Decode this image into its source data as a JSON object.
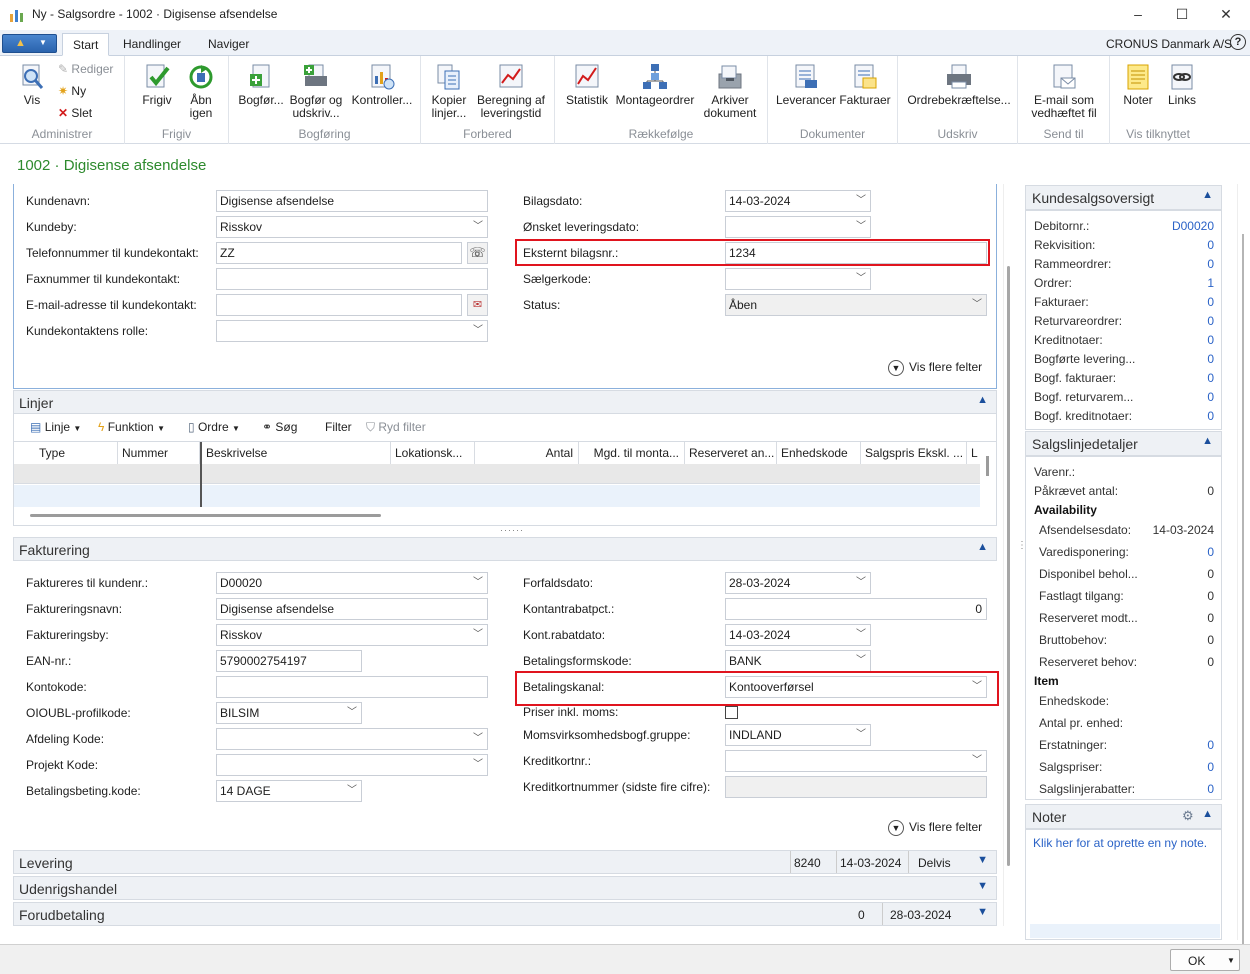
{
  "window": {
    "title": "Ny - Salgsordre - 1002 · Digisense afsendelse",
    "company": "CRONUS Danmark A/S"
  },
  "tabs": [
    "Start",
    "Handlinger",
    "Naviger"
  ],
  "ribbon": {
    "groups": [
      {
        "label": "Administrer",
        "buttons": [
          "Vis"
        ],
        "small": [
          "Rediger",
          "Ny",
          "Slet"
        ]
      },
      {
        "label": "Frigiv",
        "buttons": [
          "Frigiv",
          "Åbn igen"
        ]
      },
      {
        "label": "Bogføring",
        "buttons": [
          "Bogfør...",
          "Bogfør og udskriv...",
          "Kontroller..."
        ]
      },
      {
        "label": "Forbered",
        "buttons": [
          "Kopier linjer...",
          "Beregning af leveringstid"
        ]
      },
      {
        "label": "Rækkefølge",
        "buttons": [
          "Statistik",
          "Montageordrer",
          "Arkiver dokument"
        ]
      },
      {
        "label": "Dokumenter",
        "buttons": [
          "Leverancer",
          "Fakturaer"
        ]
      },
      {
        "label": "Udskriv",
        "buttons": [
          "Ordrebekræftelse..."
        ]
      },
      {
        "label": "Send til",
        "buttons": [
          "E-mail som vedhæftet fil"
        ]
      },
      {
        "label": "Vis tilknyttet",
        "buttons": [
          "Noter",
          "Links"
        ]
      }
    ]
  },
  "page_title": "1002 · Digisense afsendelse",
  "general": {
    "left": [
      {
        "label": "Kundenavn:",
        "value": "Digisense afsendelse"
      },
      {
        "label": "Kundeby:",
        "value": "Risskov"
      },
      {
        "label": "Telefonnummer til kundekontakt:",
        "value": "ZZ"
      },
      {
        "label": "Faxnummer til kundekontakt:",
        "value": ""
      },
      {
        "label": "E-mail-adresse til kundekontakt:",
        "value": ""
      },
      {
        "label": "Kundekontaktens rolle:",
        "value": ""
      }
    ],
    "right": [
      {
        "label": "Bilagsdato:",
        "value": "14-03-2024"
      },
      {
        "label": "Ønsket leveringsdato:",
        "value": ""
      },
      {
        "label": "Eksternt bilagsnr.:",
        "value": "1234"
      },
      {
        "label": "Sælgerkode:",
        "value": ""
      },
      {
        "label": "Status:",
        "value": "Åben"
      }
    ],
    "more": "Vis flere felter"
  },
  "lines": {
    "title": "Linjer",
    "toolbar": [
      "Linje",
      "Funktion",
      "Ordre",
      "Søg",
      "Filter",
      "Ryd filter"
    ],
    "columns": [
      "Type",
      "Nummer",
      "Beskrivelse",
      "Lokationsk...",
      "Antal",
      "Mgd. til monta...",
      "Reserveret an...",
      "Enhedskode",
      "Salgspris Ekskl. ...",
      "L"
    ]
  },
  "invoicing": {
    "title": "Fakturering",
    "left": [
      {
        "label": "Faktureres til kundenr.:",
        "value": "D00020"
      },
      {
        "label": "Faktureringsnavn:",
        "value": "Digisense afsendelse"
      },
      {
        "label": "Faktureringsby:",
        "value": "Risskov"
      },
      {
        "label": "EAN-nr.:",
        "value": "5790002754197"
      },
      {
        "label": "Kontokode:",
        "value": ""
      },
      {
        "label": "OIOUBL-profilkode:",
        "value": "BILSIM"
      },
      {
        "label": "Afdeling Kode:",
        "value": ""
      },
      {
        "label": "Projekt Kode:",
        "value": ""
      },
      {
        "label": "Betalingsbeting.kode:",
        "value": "14 DAGE"
      }
    ],
    "right": [
      {
        "label": "Forfaldsdato:",
        "value": "28-03-2024"
      },
      {
        "label": "Kontantrabatpct.:",
        "value": "0"
      },
      {
        "label": "Kont.rabatdato:",
        "value": "14-03-2024"
      },
      {
        "label": "Betalingsformskode:",
        "value": "BANK"
      },
      {
        "label": "Betalingskanal:",
        "value": "Kontooverførsel"
      },
      {
        "label": "Priser inkl. moms:",
        "value": ""
      },
      {
        "label": "Momsvirksomhedsbogf.gruppe:",
        "value": "INDLAND"
      },
      {
        "label": "Kreditkortnr.:",
        "value": ""
      },
      {
        "label": "Kreditkortnummer (sidste fire cifre):",
        "value": ""
      }
    ],
    "more": "Vis flere felter"
  },
  "collapsed": [
    {
      "title": "Levering",
      "v1": "8240",
      "v2": "14-03-2024",
      "v3": "Delvis"
    },
    {
      "title": "Udenrigshandel",
      "v1": "",
      "v2": "",
      "v3": ""
    },
    {
      "title": "Forudbetaling",
      "v1": "0",
      "v2": "28-03-2024",
      "v3": ""
    }
  ],
  "factbox": {
    "overview": {
      "title": "Kundesalgsoversigt",
      "rows": [
        {
          "label": "Debitornr.:",
          "value": "D00020"
        },
        {
          "label": "Rekvisition:",
          "value": "0"
        },
        {
          "label": "Rammeordrer:",
          "value": "0"
        },
        {
          "label": "Ordrer:",
          "value": "1"
        },
        {
          "label": "Fakturaer:",
          "value": "0"
        },
        {
          "label": "Returvareordrer:",
          "value": "0"
        },
        {
          "label": "Kreditnotaer:",
          "value": "0"
        },
        {
          "label": "Bogførte levering...",
          "value": "0"
        },
        {
          "label": "Bogf. fakturaer:",
          "value": "0"
        },
        {
          "label": "Bogf. returvarem...",
          "value": "0"
        },
        {
          "label": "Bogf. kreditnotaer:",
          "value": "0"
        }
      ]
    },
    "details": {
      "title": "Salgslinjedetaljer",
      "rows": [
        {
          "label": "Varenr.:",
          "value": ""
        },
        {
          "label": "Påkrævet antal:",
          "value": "0"
        },
        {
          "label": "Availability",
          "value": ""
        },
        {
          "label": "Afsendelsesdato:",
          "value": "14-03-2024"
        },
        {
          "label": "Varedisponering:",
          "value": "0"
        },
        {
          "label": "Disponibel behol...",
          "value": "0"
        },
        {
          "label": "Fastlagt tilgang:",
          "value": "0"
        },
        {
          "label": "Reserveret modt...",
          "value": "0"
        },
        {
          "label": "Bruttobehov:",
          "value": "0"
        },
        {
          "label": "Reserveret behov:",
          "value": "0"
        },
        {
          "label": "Item",
          "value": ""
        },
        {
          "label": "Enhedskode:",
          "value": ""
        },
        {
          "label": "Antal pr. enhed:",
          "value": ""
        },
        {
          "label": "Erstatninger:",
          "value": "0"
        },
        {
          "label": "Salgspriser:",
          "value": "0"
        },
        {
          "label": "Salgslinjerabatter:",
          "value": "0"
        }
      ]
    },
    "notes": {
      "title": "Noter",
      "link": "Klik her for at oprette en ny note."
    }
  },
  "ok_label": "OK"
}
